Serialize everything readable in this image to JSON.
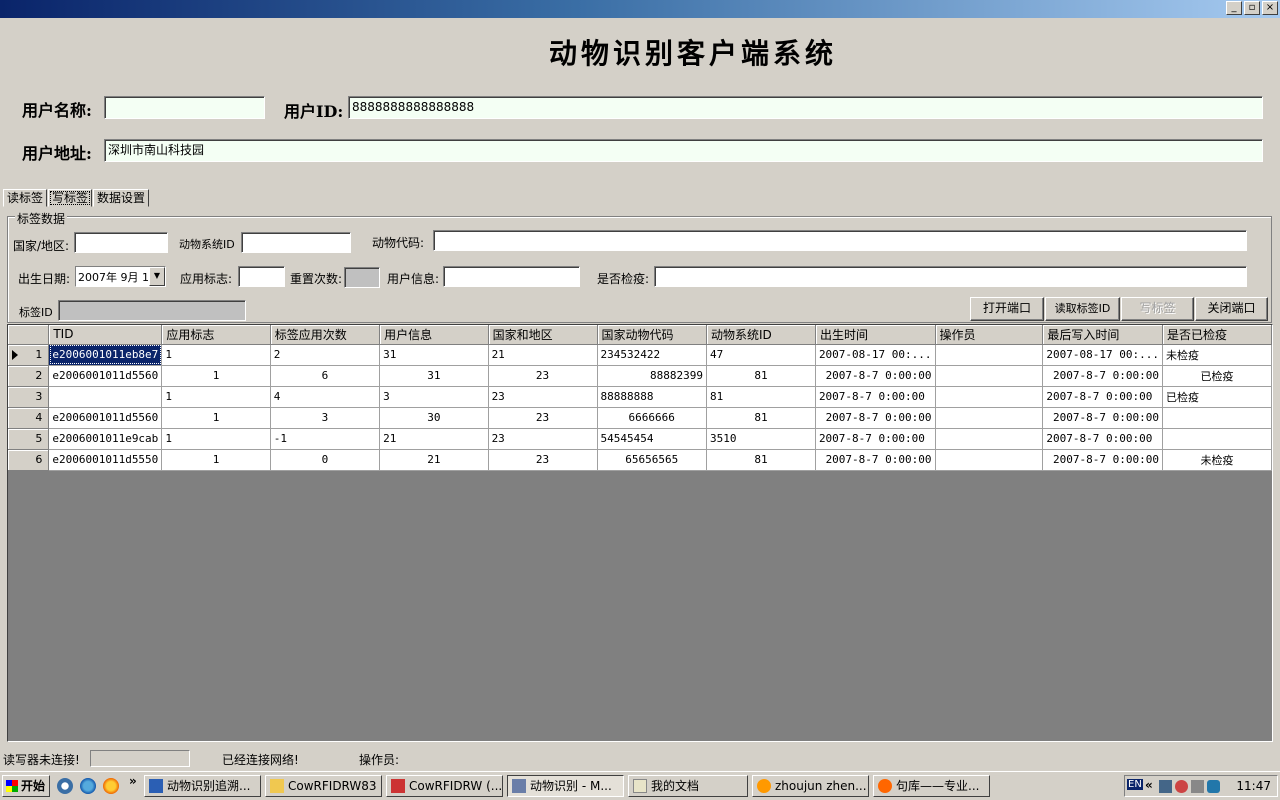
{
  "window": {
    "title": "",
    "buttons": [
      "_",
      "▫",
      "×"
    ]
  },
  "app_title": "动物识别客户端系统",
  "user": {
    "name_label": "用户名称:",
    "name_value": "",
    "id_label": "用户ID:",
    "id_value": "8888888888888888",
    "address_label": "用户地址:",
    "address_value": "深圳市南山科技园"
  },
  "tabs": [
    "读标签",
    "写标签",
    "数据设置"
  ],
  "active_tab": "写标签",
  "tag_group": {
    "legend": "标签数据",
    "country_label": "国家/地区:",
    "animal_system_id_label": "动物系统ID",
    "animal_code_label": "动物代码:",
    "birth_date_label": "出生日期:",
    "birth_date_value": "2007年 9月 1",
    "app_flag_label": "应用标志:",
    "reset_count_label": "重置次数:",
    "user_info_label": "用户信息:",
    "quarantine_label": "是否检疫:",
    "tag_id_label": "标签ID"
  },
  "buttons": {
    "open_port": "打开端口",
    "read_tag_id": "读取标签ID",
    "write_tag": "写标签",
    "close_port": "关闭端口"
  },
  "table": {
    "columns": [
      "TID",
      "应用标志",
      "标签应用次数",
      "用户信息",
      "国家和地区",
      "国家动物代码",
      "动物系统ID",
      "出生时间",
      "操作员",
      "最后写入时间",
      "是否已检疫"
    ],
    "rows": [
      [
        "1",
        "e2006001011eb8e7",
        "1",
        "2",
        "31",
        "21",
        "234532422",
        "47",
        "2007-08-17 00:...",
        "",
        "2007-08-17 00:...",
        "未检疫"
      ],
      [
        "2",
        "e2006001011d5560",
        "1",
        "6",
        "31",
        "23",
        "88882399",
        "81",
        "2007-8-7 0:00:00",
        "",
        "2007-8-7 0:00:00",
        "已检疫"
      ],
      [
        "3",
        "",
        "1",
        "4",
        "3",
        "23",
        "88888888",
        "81",
        "2007-8-7 0:00:00",
        "",
        "2007-8-7 0:00:00",
        "已检疫"
      ],
      [
        "4",
        "e2006001011d5560",
        "1",
        "3",
        "30",
        "23",
        "6666666",
        "81",
        "2007-8-7 0:00:00",
        "",
        "2007-8-7 0:00:00",
        ""
      ],
      [
        "5",
        "e2006001011e9cab",
        "1",
        "-1",
        "21",
        "23",
        "54545454",
        "3510",
        "2007-8-7 0:00:00",
        "",
        "2007-8-7 0:00:00",
        ""
      ],
      [
        "6",
        "e2006001011d5550",
        "1",
        "0",
        "21",
        "23",
        "65656565",
        "81",
        "2007-8-7 0:00:00",
        "",
        "2007-8-7 0:00:00",
        "未检疫"
      ]
    ]
  },
  "status": {
    "reader": "读写器未连接!",
    "network": "已经连接网络!",
    "operator": "操作员:"
  },
  "taskbar": {
    "start": "开始",
    "chevron": "»",
    "tasks": [
      "动物识别追溯...",
      "CowRFIDRW83",
      "CowRFIDRW (...",
      "动物识别 - M...",
      "我的文档",
      "zhoujun zhen...",
      "句库——专业..."
    ],
    "tray_lang": "EN",
    "tray_chevron": "«",
    "clock": "11:47"
  },
  "colors": {
    "title_active": "#0a246a",
    "selection": "#0a246a",
    "input_bg": "#f4fff4",
    "grid_bg": "#808080"
  }
}
